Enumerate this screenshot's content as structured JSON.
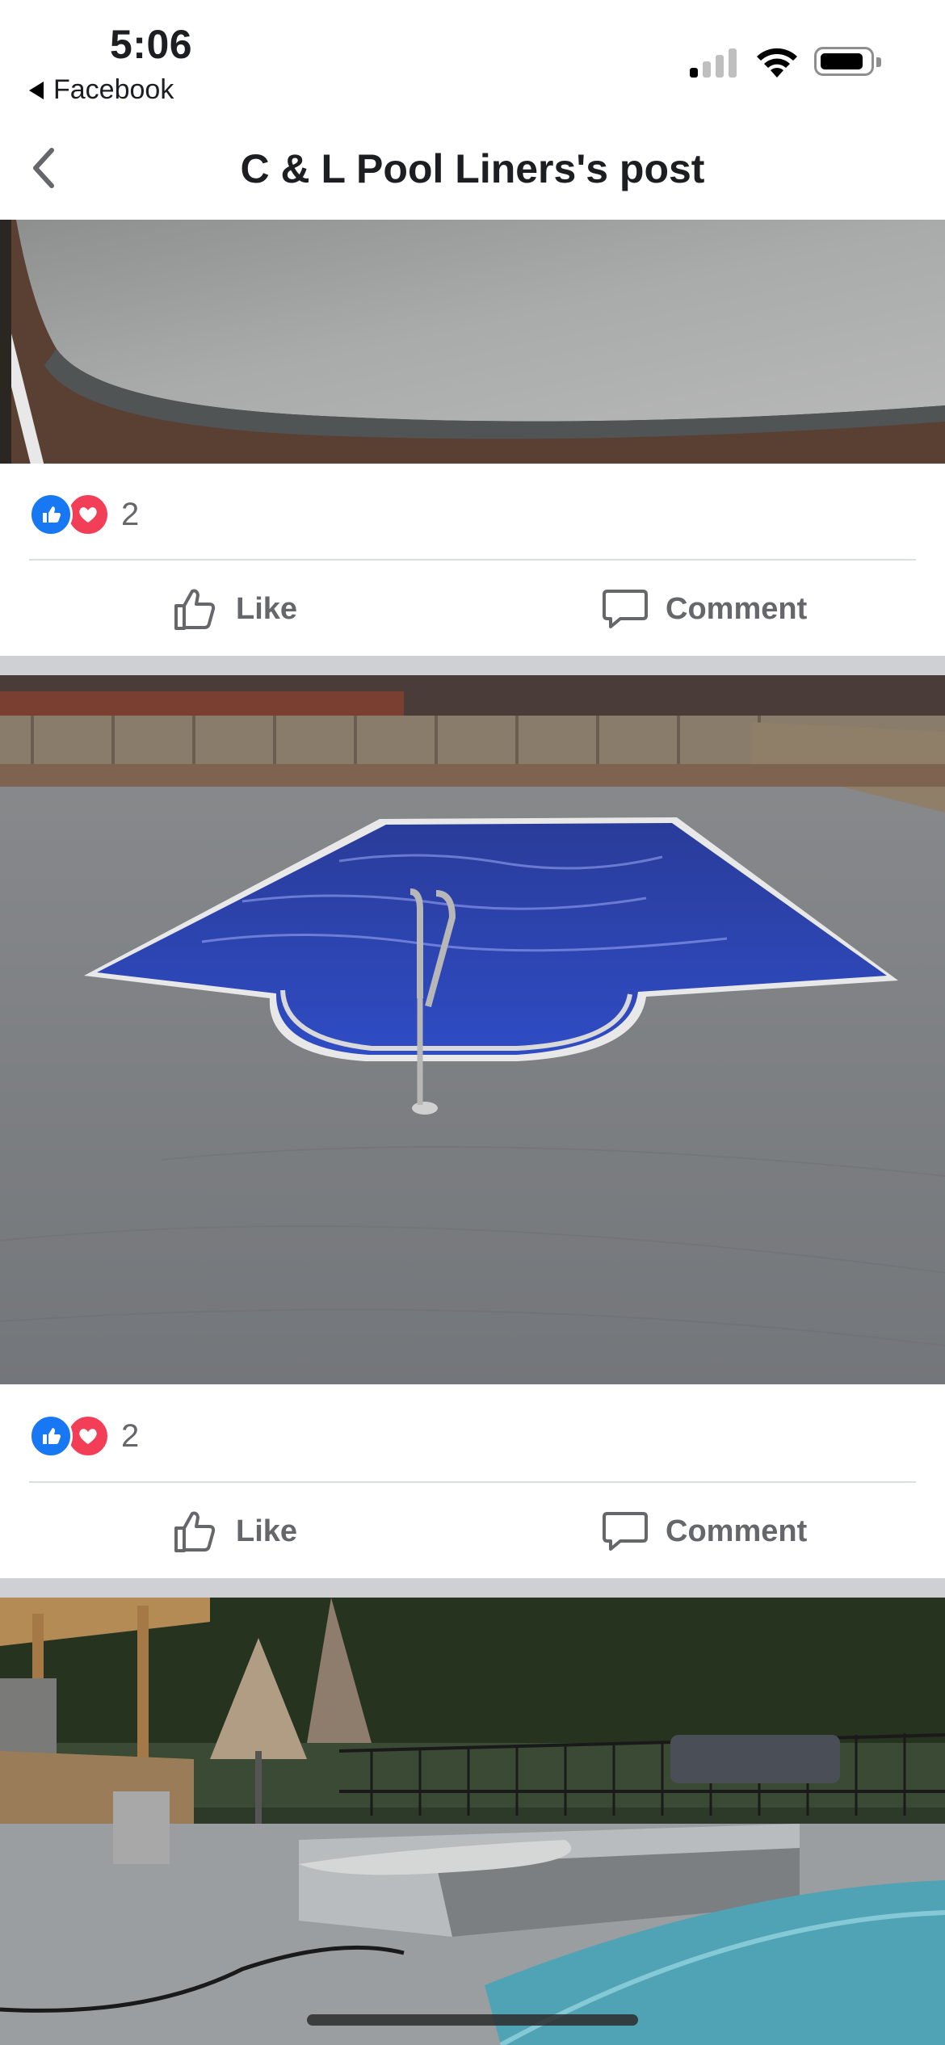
{
  "status_bar": {
    "time": "5:06",
    "back_app_label": "Facebook",
    "icons": [
      "signal-icon",
      "wifi-icon",
      "battery-icon"
    ]
  },
  "nav": {
    "title": "C & L Pool Liners's post",
    "back_icon": "chevron-left-icon"
  },
  "posts": [
    {
      "photo_description_icon": "photo",
      "reaction_icons": [
        "like-reaction-icon",
        "love-reaction-icon"
      ],
      "reaction_count": "2",
      "like_label": "Like",
      "comment_label": "Comment"
    },
    {
      "photo_description_icon": "photo",
      "reaction_icons": [
        "like-reaction-icon",
        "love-reaction-icon"
      ],
      "reaction_count": "2",
      "like_label": "Like",
      "comment_label": "Comment"
    }
  ],
  "colors": {
    "brand_blue": "#1877f2",
    "love_red": "#f33e58",
    "action_gray": "#65676b",
    "separator": "#ced0d4"
  }
}
